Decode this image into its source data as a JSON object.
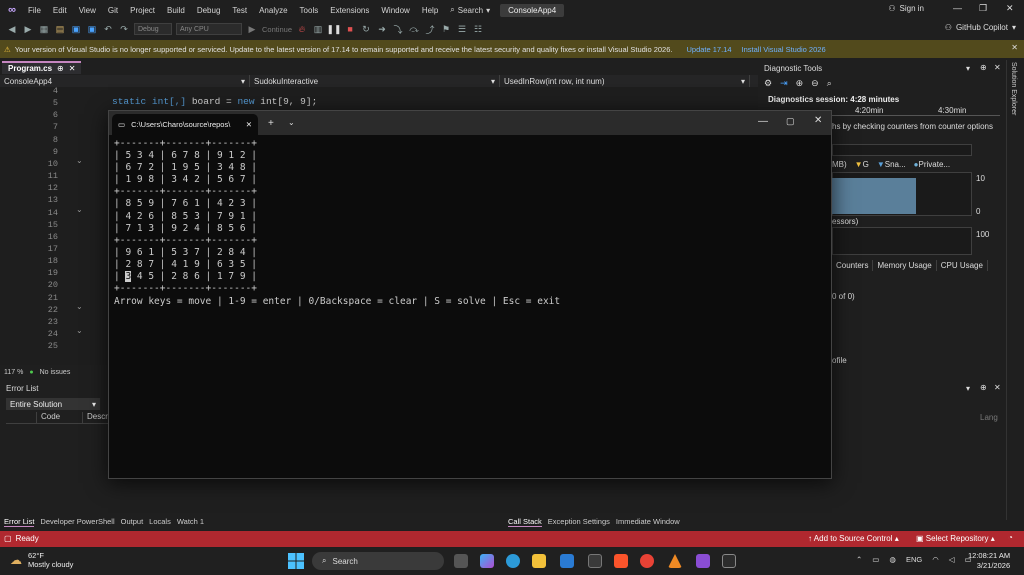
{
  "menu": {
    "items": [
      "File",
      "Edit",
      "View",
      "Git",
      "Project",
      "Build",
      "Debug",
      "Test",
      "Analyze",
      "Tools",
      "Extensions",
      "Window",
      "Help"
    ],
    "search_label": "Search",
    "solution_name": "ConsoleApp4",
    "sign_in": "Sign in"
  },
  "toolbar": {
    "config": "Debug",
    "platform": "Any CPU",
    "continue_label": "Continue",
    "copilot": "GitHub Copilot"
  },
  "infobar": {
    "message": "Your version of Visual Studio is no longer supported or serviced. Update to the latest version of 17.14 to remain supported and receive the latest security and quality fixes or install Visual Studio 2026.",
    "link_update": "Update 17.14",
    "link_install": "Install Visual Studio 2026"
  },
  "editor": {
    "file_tab": "Program.cs",
    "nav_project": "ConsoleApp4",
    "nav_class": "SudokuInteractive",
    "nav_member": "UsedInRow(int row, int num)",
    "line_numbers": [
      "4",
      "5",
      "6",
      "7",
      "8",
      "9",
      "10",
      "11",
      "12",
      "13",
      "14",
      "15",
      "16",
      "17",
      "18",
      "19",
      "20",
      "21",
      "22",
      "23",
      "24",
      "25"
    ],
    "code_line": {
      "kw_static": "static",
      "kw_int1": "int[,]",
      "name": " board = ",
      "kw_new": "new",
      "rest": " int[9, 9];"
    },
    "zoom": "117 %",
    "issues": "No issues"
  },
  "diagnostics": {
    "title": "Diagnostic Tools",
    "session": "Diagnostics session: 4:28 minutes",
    "t1": "4:20min",
    "t2": "4:30min",
    "counter_text": "hs by checking counters from counter options",
    "legend_mb": "MB)",
    "legend_g": "G",
    "legend_sna": "Sna...",
    "legend_private": "Private...",
    "axis_10": "10",
    "axis_0": "0",
    "cpu_label": "essors)",
    "axis_100": "100",
    "tabs": [
      "Counters",
      "Memory Usage",
      "CPU Usage"
    ],
    "of0": "0 of 0)",
    "profile": "ofile"
  },
  "solution_explorer": {
    "label": "Solution Explorer"
  },
  "error_list": {
    "title": "Error List",
    "scope": "Entire Solution",
    "col_code": "Code",
    "col_desc": "Descrip",
    "col_lang": "Lang"
  },
  "bottom_tabs_left": [
    "Error List",
    "Developer PowerShell",
    "Output",
    "Locals",
    "Watch 1"
  ],
  "bottom_tabs_right": [
    "Call Stack",
    "Exception Settings",
    "Immediate Window"
  ],
  "status": {
    "ready": "Ready",
    "source_control": "Add to Source Control",
    "repository": "Select Repository"
  },
  "terminal": {
    "tab_title": "C:\\Users\\Charo\\source\\repos\\",
    "sep": "+-------+-------+-------+",
    "rows": [
      [
        "| 5 3 4 | 6 7 8 | 9 1 2 |",
        "| 6 7 2 | 1 9 5 | 3 4 8 |",
        "| 1 9 8 | 3 4 2 | 5 6 7 |"
      ],
      [
        "| 8 5 9 | 7 6 1 | 4 2 3 |",
        "| 4 2 6 | 8 5 3 | 7 9 1 |",
        "| 7 1 3 | 9 2 4 | 8 5 6 |"
      ],
      [
        "| 9 6 1 | 5 3 7 | 2 8 4 |",
        "| 2 8 7 | 4 1 9 | 6 3 5 |"
      ]
    ],
    "last_row_prefix": "| ",
    "last_row_cursor": "3",
    "last_row_rest": " 4 5 | 2 8 6 | 1 7 9 |",
    "help": "Arrow keys = move | 1-9 = enter | 0/Backspace = clear | S = solve | Esc = exit"
  },
  "taskbar": {
    "temp": "62°F",
    "weather": "Mostly cloudy",
    "search": "Search",
    "lang": "ENG",
    "time": "12:08:21 AM",
    "date": "3/21/2026"
  },
  "colors": {
    "status_bar": "#b0282f",
    "accent": "#c586c0",
    "terminal_bg": "#0c0c0c"
  }
}
